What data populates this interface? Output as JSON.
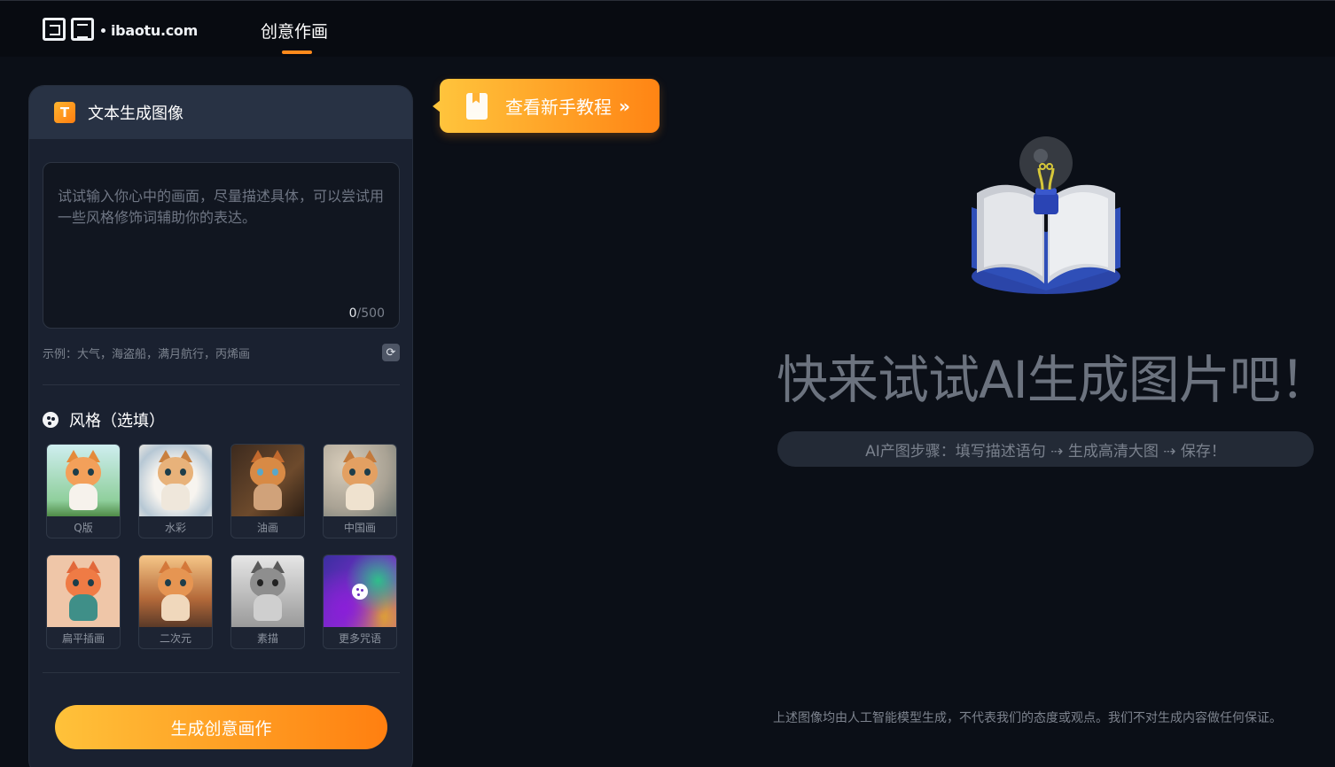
{
  "header": {
    "logo_domain": "ibaotu.com",
    "nav_tab_label": "创意作画",
    "accent_color": "#ff8a1c"
  },
  "panel": {
    "title": "文本生成图像",
    "title_icon": "t-icon",
    "prompt": {
      "placeholder": "试试输入你心中的画面，尽量描述具体，可以尝试用一些风格修饰词辅助你的表达。",
      "value": "",
      "count_current": "0",
      "count_max": "/500"
    },
    "example_text": "示例：大气，海盗船，满月航行，丙烯画",
    "refresh_icon": "refresh-icon",
    "style_section_title": "风格（选填）",
    "styles": [
      {
        "label": "Q版"
      },
      {
        "label": "水彩"
      },
      {
        "label": "油画"
      },
      {
        "label": "中国画"
      },
      {
        "label": "扁平插画"
      },
      {
        "label": "二次元"
      },
      {
        "label": "素描"
      },
      {
        "label": "更多咒语"
      }
    ],
    "generate_button": "生成创意画作"
  },
  "tutorial": {
    "label": "查看新手教程",
    "chevron": "»"
  },
  "empty_state": {
    "title": "快来试试AI生成图片吧！",
    "steps": "AI产图步骤：填写描述语句 ⇢ 生成高清大图 ⇢ 保存！",
    "disclaimer": "上述图像均由人工智能模型生成，不代表我们的态度或观点。我们不对生成内容做任何保证。"
  }
}
